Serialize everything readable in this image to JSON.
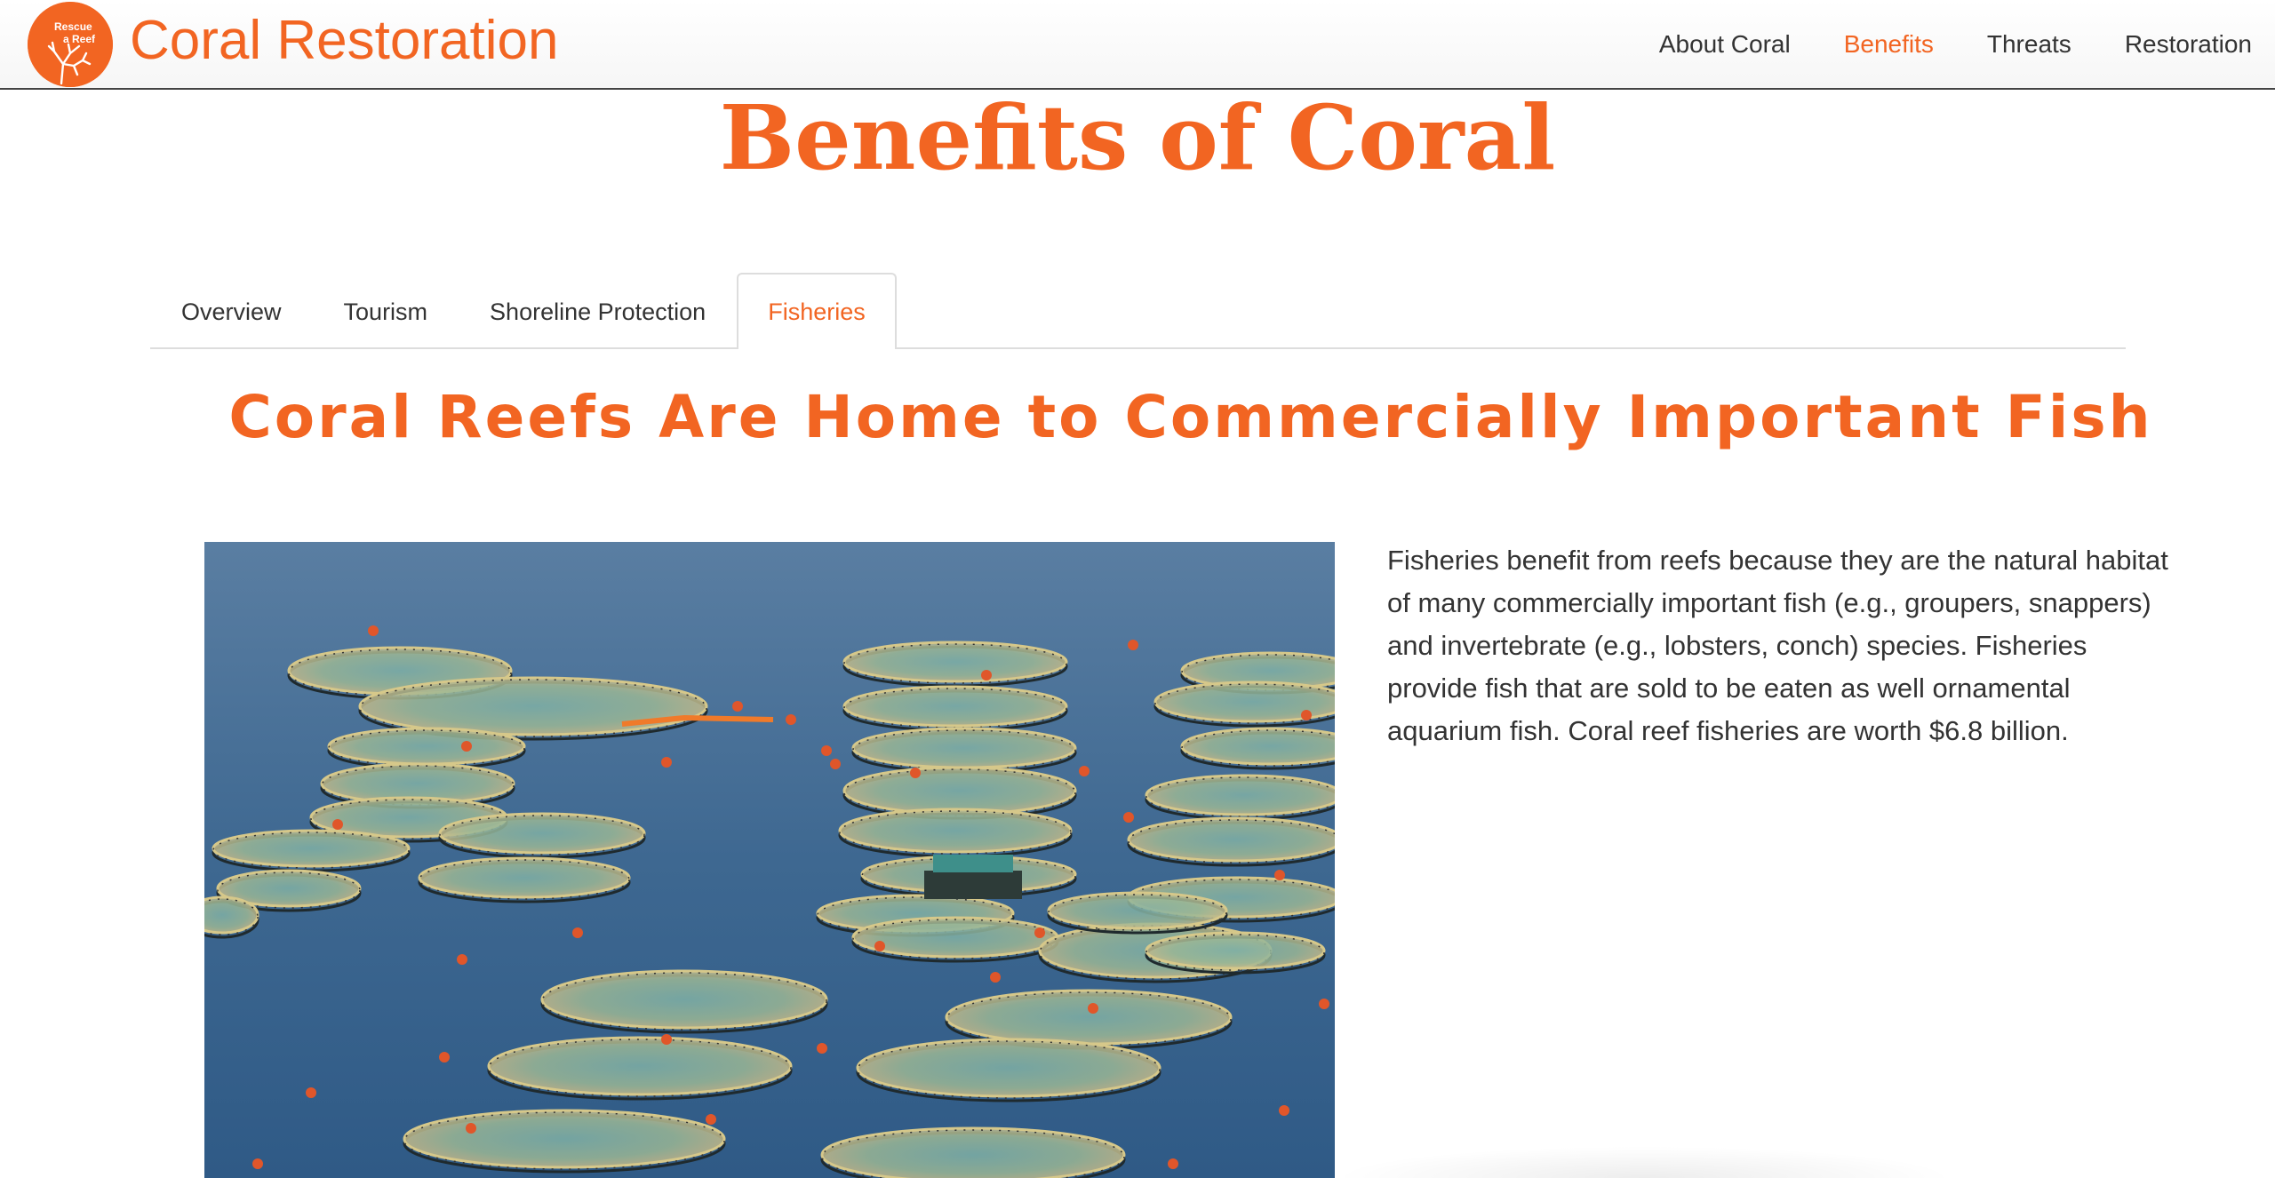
{
  "brand": {
    "logo_text_line1": "Rescue",
    "logo_text_line2": "a Reef",
    "title": "Coral Restoration",
    "accent_color": "#f26522"
  },
  "nav": {
    "items": [
      {
        "label": "About Coral",
        "active": false
      },
      {
        "label": "Benefits",
        "active": true
      },
      {
        "label": "Threats",
        "active": false
      },
      {
        "label": "Restoration",
        "active": false
      }
    ]
  },
  "page": {
    "title": "Benefits of Coral"
  },
  "tabs": [
    {
      "label": "Overview",
      "active": false
    },
    {
      "label": "Tourism",
      "active": false
    },
    {
      "label": "Shoreline Protection",
      "active": false
    },
    {
      "label": "Fisheries",
      "active": true
    }
  ],
  "section": {
    "heading": "Coral Reefs Are Home to Commercially Important Fish",
    "body": "Fisheries benefit from reefs because they are the natural habitat of many commercially important fish (e.g., groupers, snappers) and invertebrate (e.g., lobsters, conch) species. Fisheries provide fish that are sold to be eaten as well ornamental aquarium fish. Coral reef fisheries are worth $6.8 billion."
  },
  "photo": {
    "subject": "circular fish farm pens floating on blue sea"
  }
}
